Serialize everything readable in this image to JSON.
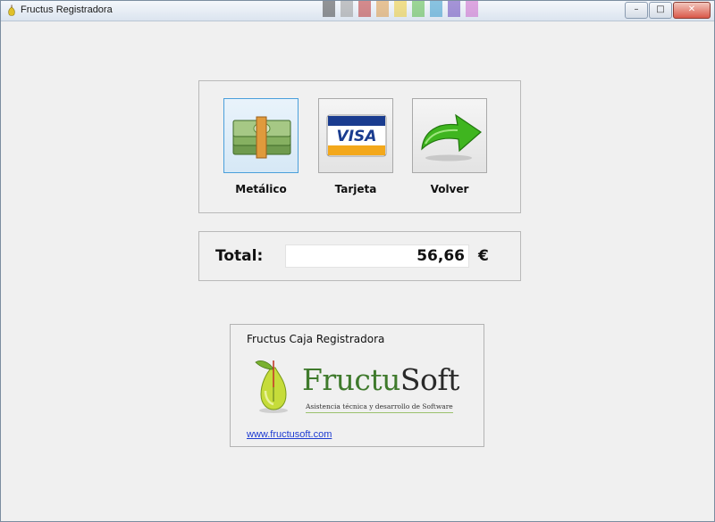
{
  "window": {
    "title": "Fructus Registradora",
    "minimize": "–",
    "maximize": "□",
    "close": "✕"
  },
  "payment": {
    "cash_label": "Metálico",
    "card_label": "Tarjeta",
    "card_brand": "VISA",
    "back_label": "Volver"
  },
  "total": {
    "label": "Total:",
    "value": "56,66",
    "currency": "€"
  },
  "about": {
    "title": "Fructus Caja Registradora",
    "brand_fructu": "Fructu",
    "brand_soft": "Soft",
    "tagline": "Asistencia técnica y desarrollo de Software",
    "link": "www.fructusoft.com"
  },
  "colors": {
    "selected_border": "#4a9fdb",
    "link": "#1d3bd1",
    "brand_green": "#3f7a2c",
    "arrow_green": "#3fb51f",
    "visa_blue": "#1a3c8f",
    "visa_gold": "#f3a81b"
  },
  "icons": [
    "app-pear-icon",
    "cash-icon",
    "visa-card-icon",
    "return-arrow-icon",
    "fructusoft-pear-icon"
  ]
}
